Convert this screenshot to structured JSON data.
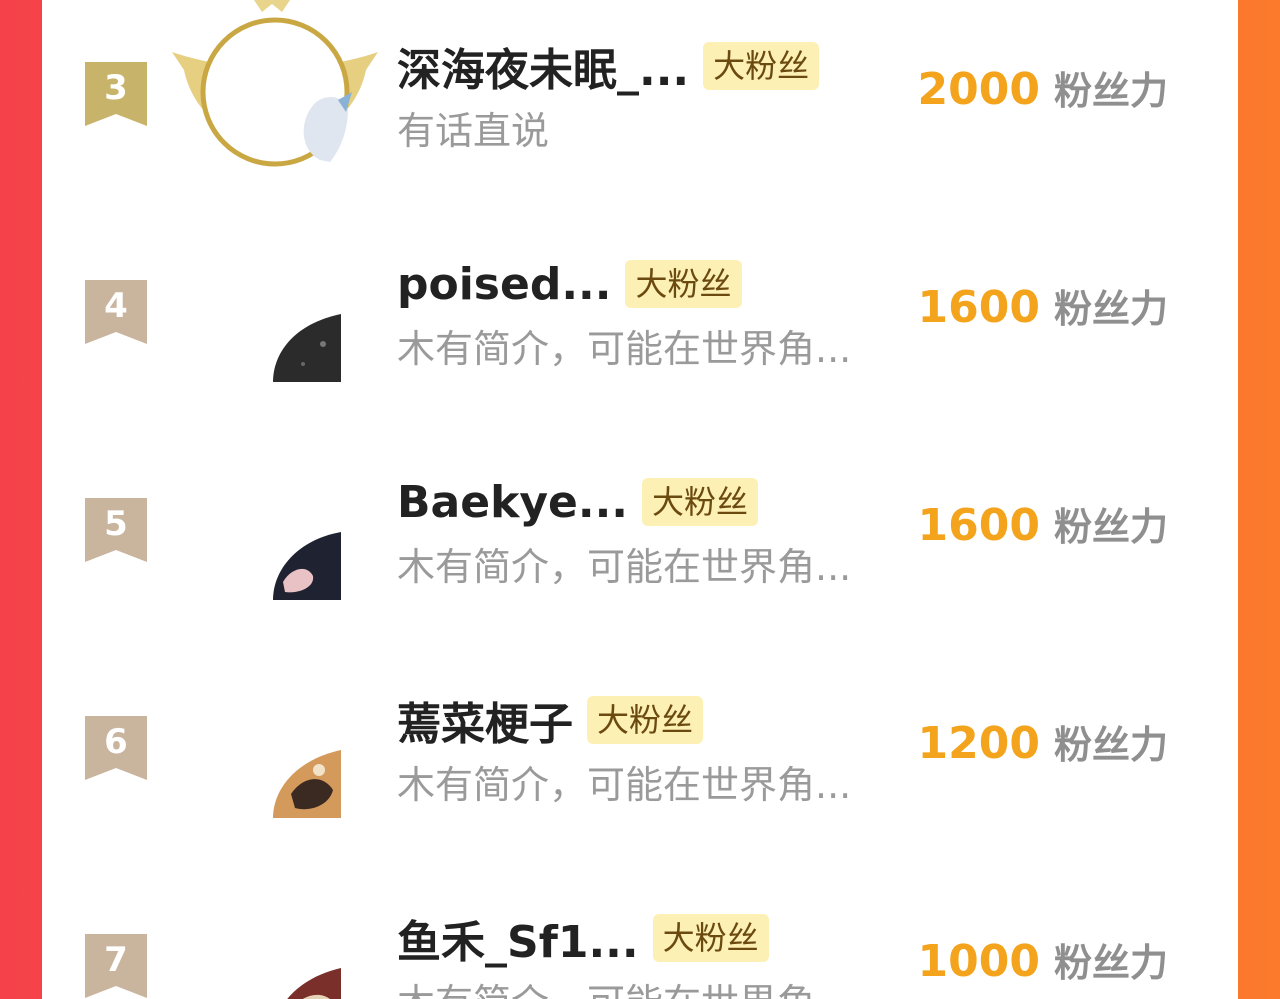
{
  "colors": {
    "bg_left": "#f5424a",
    "bg_right": "#fb7a2b",
    "panel": "#ffffff",
    "badge_bg": "#fdf0b4",
    "power_value": "#f3a31c",
    "rank_gold": "#c8b36a",
    "rank_bronze": "#c9b49e"
  },
  "rows": [
    {
      "rank": "3",
      "rank_style": "gold",
      "name": "深海夜未眠_...",
      "badge": "大粉丝",
      "bio": "有话直说",
      "power_value": "2000",
      "power_label": "粉丝力",
      "avatar_icon": "crown-frame-avatar-icon"
    },
    {
      "rank": "4",
      "rank_style": "bronze",
      "name": "poised...",
      "badge": "大粉丝",
      "bio": "木有简介，可能在世界角...",
      "power_value": "1600",
      "power_label": "粉丝力",
      "avatar_icon": "user-avatar-icon"
    },
    {
      "rank": "5",
      "rank_style": "bronze",
      "name": "Baekye...",
      "badge": "大粉丝",
      "bio": "木有简介，可能在世界角...",
      "power_value": "1600",
      "power_label": "粉丝力",
      "avatar_icon": "user-avatar-icon"
    },
    {
      "rank": "6",
      "rank_style": "bronze",
      "name": "蔫菜梗子",
      "badge": "大粉丝",
      "bio": "木有简介，可能在世界角...",
      "power_value": "1200",
      "power_label": "粉丝力",
      "avatar_icon": "user-avatar-icon"
    },
    {
      "rank": "7",
      "rank_style": "bronze",
      "name": "鱼禾_Sf1...",
      "badge": "大粉丝",
      "bio": "木有简介，可能在世界角",
      "power_value": "1000",
      "power_label": "粉丝力",
      "avatar_icon": "user-avatar-icon"
    }
  ]
}
